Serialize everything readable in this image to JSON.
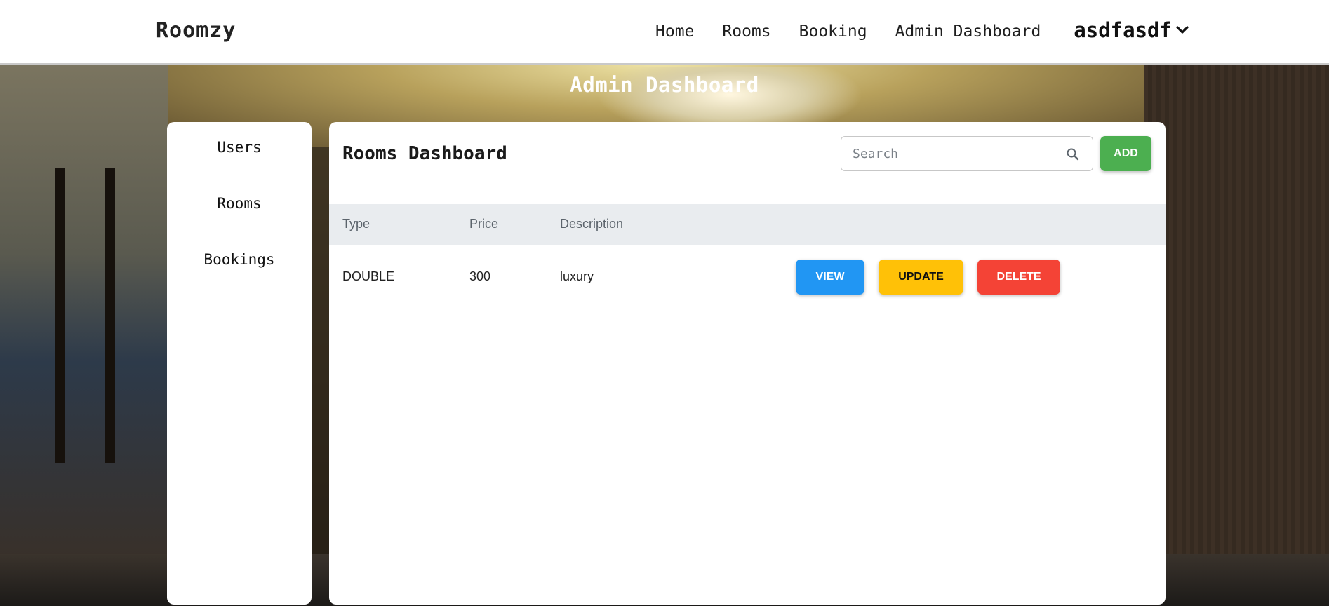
{
  "navbar": {
    "brand": "Roomzy",
    "links": [
      "Home",
      "Rooms",
      "Booking",
      "Admin Dashboard"
    ],
    "user": "asdfasdf"
  },
  "page_title": "Admin Dashboard",
  "sidebar": {
    "items": [
      "Users",
      "Rooms",
      "Bookings"
    ]
  },
  "main": {
    "title": "Rooms Dashboard",
    "search_placeholder": "Search",
    "add_label": "ADD",
    "columns": [
      "Type",
      "Price",
      "Description"
    ],
    "rows": [
      {
        "type": "DOUBLE",
        "price": "300",
        "description": "luxury",
        "actions": {
          "view": "VIEW",
          "update": "UPDATE",
          "delete": "DELETE"
        }
      }
    ]
  },
  "colors": {
    "add": "#4caf50",
    "view": "#2196f3",
    "update": "#ffc107",
    "delete": "#f44336"
  },
  "icons": {
    "search": "search-icon",
    "user_menu": "chevron-down-icon"
  }
}
